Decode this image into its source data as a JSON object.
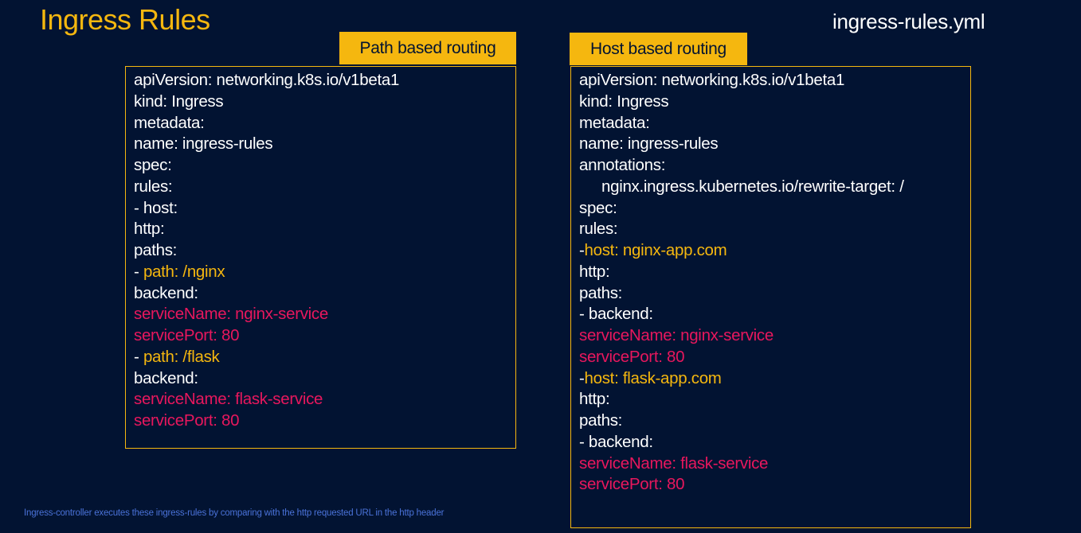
{
  "title": "Ingress Rules",
  "file_name": "ingress-rules.yml",
  "path_panel": {
    "label": "Path based routing",
    "lines": [
      {
        "segments": [
          {
            "text": "apiVersion: networking.k8s.io/v1beta1",
            "color": "white"
          }
        ]
      },
      {
        "segments": [
          {
            "text": "kind: Ingress",
            "color": "white"
          }
        ]
      },
      {
        "segments": [
          {
            "text": "metadata:",
            "color": "white"
          }
        ]
      },
      {
        "segments": [
          {
            "text": "name: ingress-rules",
            "color": "white"
          }
        ]
      },
      {
        "segments": [
          {
            "text": "spec:",
            "color": "white"
          }
        ]
      },
      {
        "segments": [
          {
            "text": "rules:",
            "color": "white"
          }
        ]
      },
      {
        "segments": [
          {
            "text": "- host:",
            "color": "white"
          }
        ]
      },
      {
        "segments": [
          {
            "text": "http:",
            "color": "white"
          }
        ]
      },
      {
        "segments": [
          {
            "text": "paths:",
            "color": "white"
          }
        ]
      },
      {
        "segments": [
          {
            "text": "- ",
            "color": "white"
          },
          {
            "text": "path: /nginx",
            "color": "yellow"
          }
        ]
      },
      {
        "segments": [
          {
            "text": "backend:",
            "color": "white"
          }
        ]
      },
      {
        "segments": [
          {
            "text": "serviceName: nginx-service",
            "color": "red"
          }
        ]
      },
      {
        "segments": [
          {
            "text": "servicePort: 80",
            "color": "red"
          }
        ]
      },
      {
        "segments": [
          {
            "text": "- ",
            "color": "white"
          },
          {
            "text": "path: /flask",
            "color": "yellow"
          }
        ]
      },
      {
        "segments": [
          {
            "text": "backend:",
            "color": "white"
          }
        ]
      },
      {
        "segments": [
          {
            "text": "serviceName: flask-service",
            "color": "red"
          }
        ]
      },
      {
        "segments": [
          {
            "text": "servicePort: 80",
            "color": "red"
          }
        ]
      }
    ]
  },
  "host_panel": {
    "label": "Host based routing",
    "lines": [
      {
        "segments": [
          {
            "text": "apiVersion: networking.k8s.io/v1beta1",
            "color": "white"
          }
        ]
      },
      {
        "segments": [
          {
            "text": "kind: Ingress",
            "color": "white"
          }
        ]
      },
      {
        "segments": [
          {
            "text": "metadata:",
            "color": "white"
          }
        ]
      },
      {
        "segments": [
          {
            "text": "name: ingress-rules",
            "color": "white"
          }
        ]
      },
      {
        "segments": [
          {
            "text": "annotations:",
            "color": "white"
          }
        ]
      },
      {
        "indent": true,
        "segments": [
          {
            "text": "nginx.ingress.kubernetes.io/rewrite-target: /",
            "color": "white"
          }
        ]
      },
      {
        "segments": [
          {
            "text": "spec:",
            "color": "white"
          }
        ]
      },
      {
        "segments": [
          {
            "text": "rules:",
            "color": "white"
          }
        ]
      },
      {
        "segments": [
          {
            "text": "-",
            "color": "white"
          },
          {
            "text": "host: nginx-app.com",
            "color": "yellow"
          }
        ]
      },
      {
        "segments": [
          {
            "text": "http:",
            "color": "white"
          }
        ]
      },
      {
        "segments": [
          {
            "text": "paths:",
            "color": "white"
          }
        ]
      },
      {
        "segments": [
          {
            "text": "- backend:",
            "color": "white"
          }
        ]
      },
      {
        "segments": [
          {
            "text": "serviceName: nginx-service",
            "color": "red"
          }
        ]
      },
      {
        "segments": [
          {
            "text": "servicePort: 80",
            "color": "red"
          }
        ]
      },
      {
        "segments": [
          {
            "text": "-",
            "color": "white"
          },
          {
            "text": "host: flask-app.com",
            "color": "yellow"
          }
        ]
      },
      {
        "segments": [
          {
            "text": "http:",
            "color": "white"
          }
        ]
      },
      {
        "segments": [
          {
            "text": "paths:",
            "color": "white"
          }
        ]
      },
      {
        "segments": [
          {
            "text": "- backend:",
            "color": "white"
          }
        ]
      },
      {
        "segments": [
          {
            "text": "serviceName: flask-service",
            "color": "red"
          }
        ]
      },
      {
        "segments": [
          {
            "text": "servicePort: 80",
            "color": "red"
          }
        ]
      }
    ]
  },
  "footnote": "Ingress-controller executes these ingress-rules by comparing with the http requested URL in the http header",
  "colors": {
    "background": "#021332",
    "accent_yellow": "#f5b70f",
    "highlight_red": "#e8175d",
    "footnote_blue": "#4a72d8"
  }
}
